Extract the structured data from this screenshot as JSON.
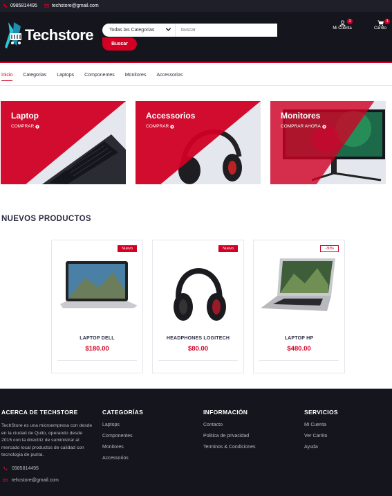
{
  "topbar": {
    "phone": "0985814495",
    "email": "techstore@gmail.com"
  },
  "header": {
    "logo_text": "Techstore",
    "search_category": "Todas las Categorias",
    "search_placeholder": "buscar",
    "search_button": "Buscar",
    "account_label": "Mi Cuenta",
    "account_badge": "3",
    "cart_label": "Carrito",
    "cart_badge": "3"
  },
  "nav": {
    "items": [
      "Inicio",
      "Categorias",
      "Laptops",
      "Componentes",
      "Monitores",
      "Accessorios"
    ]
  },
  "categories": [
    {
      "title": "Laptop",
      "cta": "COMPRAR"
    },
    {
      "title": "Accessorios",
      "cta": "COMPRAR"
    },
    {
      "title": "Monitores",
      "cta": "COMPRAR AHORA"
    }
  ],
  "section_title": "NUEVOS PRODUCTOS",
  "products": [
    {
      "tag": "Nuevo",
      "name": "LAPTOP DELL",
      "price": "$180.00"
    },
    {
      "tag": "Nuevo",
      "name": "HEADPHONES LOGITECH",
      "price": "$80.00"
    },
    {
      "tag": "-30%",
      "name": "LAPTOP HP",
      "price": "$480.00"
    }
  ],
  "footer": {
    "about": {
      "title": "ACERCA DE TECHSTORE",
      "text": "TechStore es una microempresa con desde en la ciudad de Quito, operando desde 2015 con la directriz de suministrar al mercado local productos de calidad con tecnologia de punta.",
      "phone": "0985814495",
      "email": "tehcstore@gmail.com"
    },
    "categories": {
      "title": "CATEGORÍAS",
      "links": [
        "Laptops",
        "Componentes",
        "Monitores",
        "Accessorios"
      ]
    },
    "info": {
      "title": "INFORMACIÓN",
      "links": [
        "Contacto",
        "Politica de privacidad",
        "Terminos & Condiciones"
      ]
    },
    "services": {
      "title": "SERVICIOS",
      "links": [
        "Mi Cuenta",
        "Ver Carrito",
        "Ayuda"
      ]
    }
  },
  "colors": {
    "accent": "#d10024",
    "dark": "#15161d",
    "topbar": "#1e1f29"
  }
}
